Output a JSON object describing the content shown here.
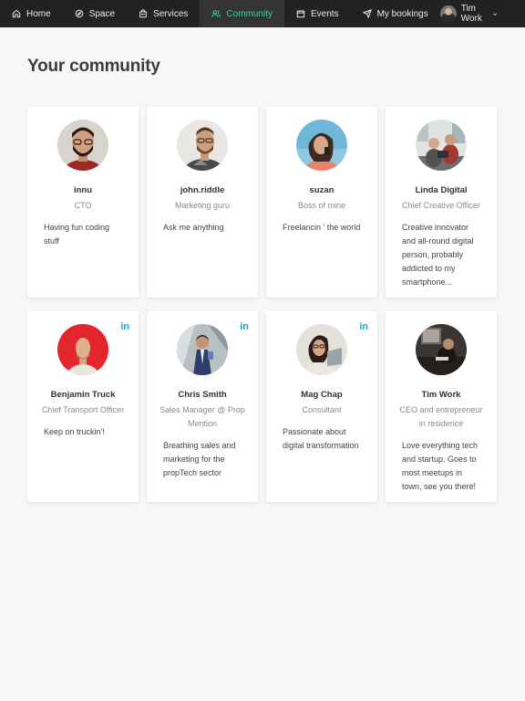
{
  "nav": {
    "items": [
      {
        "label": "Home",
        "icon": "home-icon",
        "active": false
      },
      {
        "label": "Space",
        "icon": "compass-icon",
        "active": false
      },
      {
        "label": "Services",
        "icon": "bag-icon",
        "active": false
      },
      {
        "label": "Community",
        "icon": "users-icon",
        "active": true
      },
      {
        "label": "Events",
        "icon": "calendar-icon",
        "active": false
      },
      {
        "label": "My bookings",
        "icon": "send-icon",
        "active": false
      }
    ],
    "user_name": "Tim Work",
    "active_color": "#3ecf9b"
  },
  "page": {
    "title": "Your community"
  },
  "members": [
    {
      "name": "innu",
      "role": "CTO",
      "bio": "Having fun coding stuff",
      "linkedin": "",
      "avatar": "photo-bearded-man"
    },
    {
      "name": "john.riddle",
      "role": "Marketing guru",
      "bio": "Ask me anything",
      "linkedin": "",
      "avatar": "photo-man-glasses"
    },
    {
      "name": "suzan",
      "role": "Boss of mine",
      "bio": "Freelancin ' the world",
      "linkedin": "",
      "avatar": "photo-woman-phone"
    },
    {
      "name": "Linda Digital",
      "role": "Chief Creative Officer",
      "bio": "Creative innovator and all-round digital person, probably addicted to my smartphone...",
      "linkedin": "",
      "avatar": "photo-office-team"
    },
    {
      "name": "Benjamin Truck",
      "role": "Chief Transport Officer",
      "bio": "Keep on truckin'!",
      "linkedin": "in",
      "avatar": "photo-man-red-bg"
    },
    {
      "name": "Chris Smith",
      "role": "Sales Manager @ Prop Mention",
      "bio": "Breathing sales and marketing for the propTech sector",
      "linkedin": "in",
      "avatar": "photo-man-suit"
    },
    {
      "name": "Mag Chap",
      "role": "Consultant",
      "bio": "Passionate about digital transformation",
      "linkedin": "in",
      "avatar": "photo-woman-laptop"
    },
    {
      "name": "Tim Work",
      "role": "CEO and entrepreneur in residence",
      "bio": "Love everything tech and startup. Goes to most meetups in town, see you there!",
      "linkedin": "",
      "avatar": "photo-man-desk"
    }
  ],
  "linkedin_color": "#1aa7d6"
}
